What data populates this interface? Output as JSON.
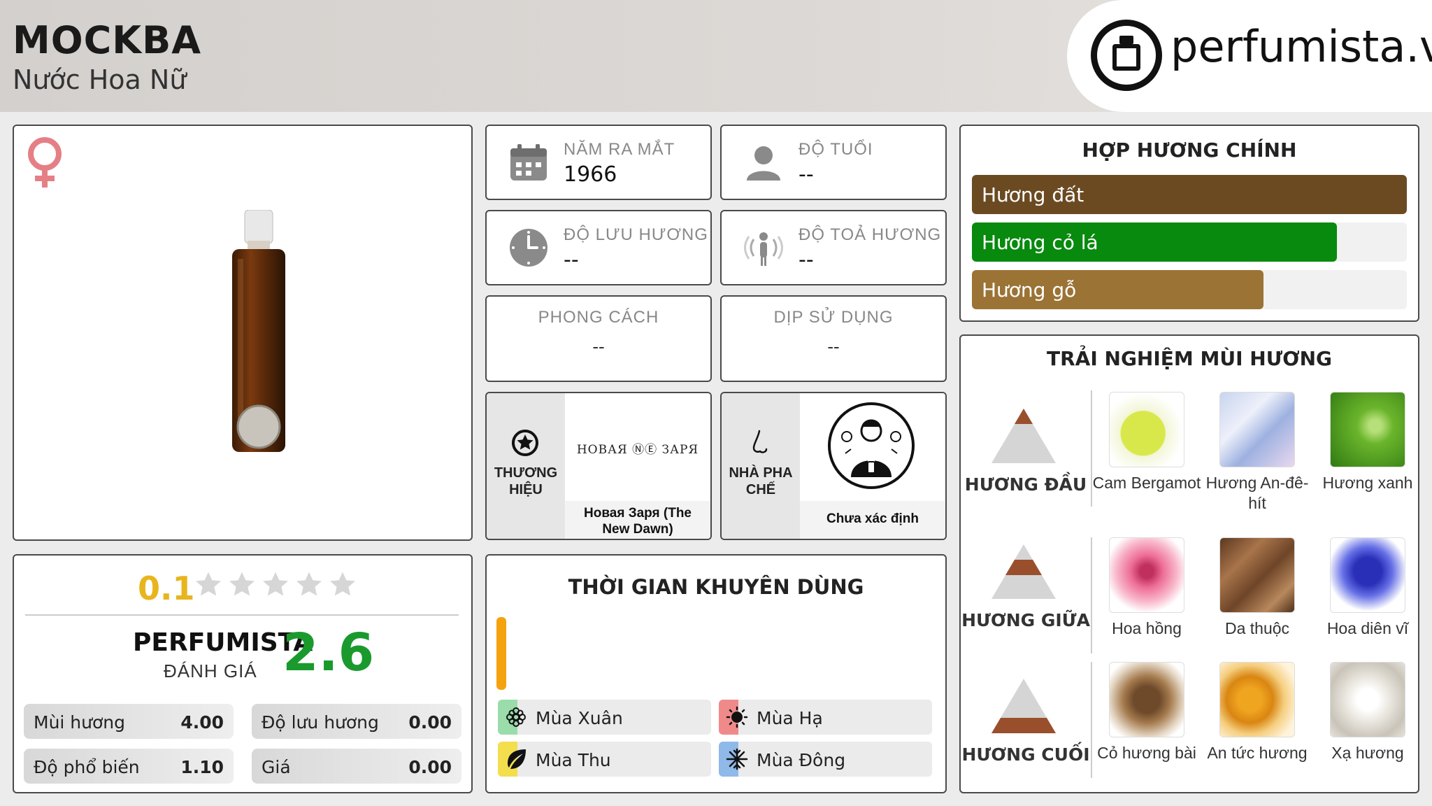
{
  "header": {
    "title": "MOCKBA",
    "subtitle": "Nước Hoa Nữ",
    "logo_text": "perfumista.vn"
  },
  "product_image": {
    "gender_icon": "female-symbol-icon",
    "gender_color": "#e57f86"
  },
  "rating": {
    "user_score": "0.1",
    "stars_total": 5,
    "star_color_empty": "#d6d6d6",
    "perfumista_label": "PERFUMISTA",
    "perfumista_sub": "ĐÁNH GIÁ",
    "perfumista_score": "2.6",
    "stats": [
      {
        "label": "Mùi hương",
        "value": "4.00"
      },
      {
        "label": "Độ lưu hương",
        "value": "0.00"
      },
      {
        "label": "Độ phổ biến",
        "value": "1.10"
      },
      {
        "label": "Giá",
        "value": "0.00"
      }
    ]
  },
  "info": {
    "release_year": {
      "label": "NĂM RA MẮT",
      "value": "1966",
      "icon": "calendar-icon"
    },
    "age": {
      "label": "ĐỘ TUỔI",
      "value": "--",
      "icon": "user-icon"
    },
    "longevity": {
      "label": "ĐỘ LƯU HƯƠNG",
      "value": "--",
      "icon": "clock-icon"
    },
    "sillage": {
      "label": "ĐỘ TOẢ HƯƠNG",
      "value": "--",
      "icon": "sillage-icon"
    },
    "style": {
      "label": "PHONG CÁCH",
      "value": "--"
    },
    "occasion": {
      "label": "DỊP SỬ DỤNG",
      "value": "--"
    }
  },
  "brand": {
    "side_label": "THƯƠNG HIỆU",
    "logo_text": "НОВАЯ ⓃⒺ ЗАРЯ",
    "name": "Новая Заря (The New Dawn)"
  },
  "perfumer": {
    "side_label": "NHÀ PHA CHẾ",
    "name": "Chưa xác định"
  },
  "time": {
    "title": "THỜI GIAN KHUYÊN DÙNG",
    "bar_color": "#f5a20f",
    "seasons": [
      {
        "label": "Mùa Xuân",
        "icon": "flower-icon",
        "color": "#9bdcab"
      },
      {
        "label": "Mùa Hạ",
        "icon": "sun-icon",
        "color": "#f08a8a"
      },
      {
        "label": "Mùa Thu",
        "icon": "leaf-icon",
        "color": "#f3de4e"
      },
      {
        "label": "Mùa Đông",
        "icon": "snowflake-icon",
        "color": "#8fb9e8"
      }
    ]
  },
  "accords": {
    "title": "HỢP HƯƠNG CHÍNH",
    "items": [
      {
        "label": "Hương đất",
        "percent": 100,
        "color": "#6b4a22"
      },
      {
        "label": "Hương cỏ lá",
        "percent": 84,
        "color": "#078a0d"
      },
      {
        "label": "Hương gỗ",
        "percent": 67,
        "color": "#9a7335"
      }
    ]
  },
  "notes": {
    "title": "TRẢI NGHIỆM MÙI HƯƠNG",
    "tiers": [
      {
        "label": "HƯƠNG ĐẦU",
        "items": [
          "Cam Bergamot",
          "Hương An-đê-hít",
          "Hương xanh"
        ]
      },
      {
        "label": "HƯƠNG GIỮA",
        "items": [
          "Hoa hồng",
          "Da thuộc",
          "Hoa diên vĩ"
        ]
      },
      {
        "label": "HƯƠNG CUỐI",
        "items": [
          "Cỏ hương bài",
          "An tức hương",
          "Xạ hương"
        ]
      }
    ]
  }
}
